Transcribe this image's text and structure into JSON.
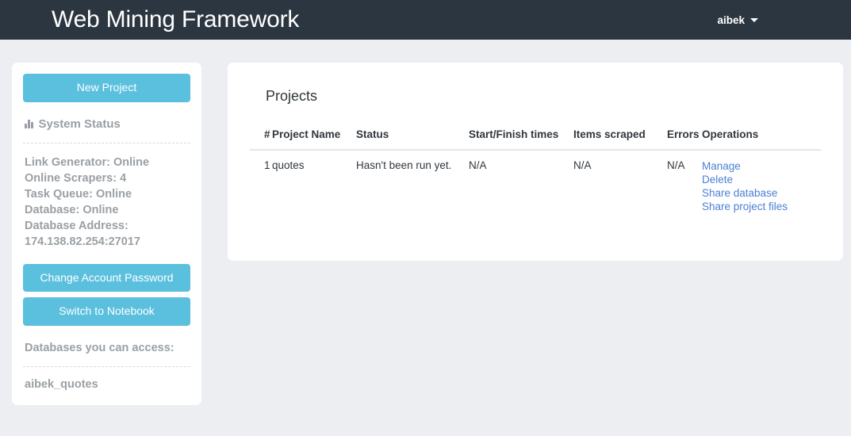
{
  "navbar": {
    "brand": "Web Mining Framework",
    "user": "aibek",
    "caret_icon": "chevron-down-icon"
  },
  "sidebar": {
    "new_project_label": "New Project",
    "system_status": {
      "icon": "bar-chart-icon",
      "label": "System Status",
      "items": [
        "Link Generator: Online",
        "Online Scrapers: 4",
        "Task Queue: Online",
        "Database: Online",
        "Database Address:",
        "174.138.82.254:27017"
      ]
    },
    "change_password_label": "Change Account Password",
    "switch_notebook_label": "Switch to Notebook",
    "databases_heading": "Databases you can access:",
    "databases": [
      "aibek_quotes"
    ]
  },
  "main": {
    "title": "Projects",
    "columns": [
      "#",
      "Project Name",
      "Status",
      "Start/Finish times",
      "Items scraped",
      "Errors",
      "Operations"
    ],
    "rows": [
      {
        "num": "1",
        "name": "quotes",
        "status": "Hasn't been run yet.",
        "times": "N/A",
        "items": "N/A",
        "errors": "N/A",
        "operations": [
          "Manage",
          "Delete",
          "Share database",
          "Share project files"
        ]
      }
    ]
  },
  "colors": {
    "navbar_bg": "#2c3640",
    "page_bg": "#eceef1",
    "button": "#5bc0de",
    "link": "#4a7fd6",
    "muted_text": "#9aa0a5"
  }
}
